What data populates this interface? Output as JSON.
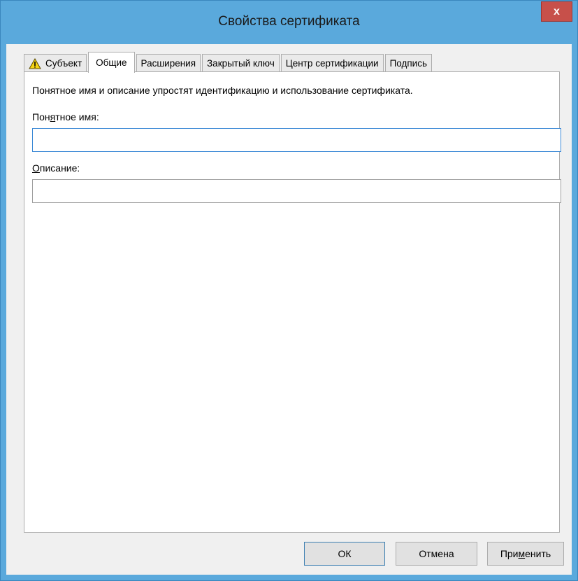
{
  "window": {
    "title": "Свойства сертификата",
    "close_label": "x"
  },
  "tabs": [
    {
      "label": "Субъект",
      "icon": "warning-icon"
    },
    {
      "label": "Общие"
    },
    {
      "label": "Расширения"
    },
    {
      "label": "Закрытый ключ"
    },
    {
      "label": "Центр сертификации"
    },
    {
      "label": "Подпись"
    }
  ],
  "general": {
    "description": "Понятное имя и описание упростят идентификацию и использование сертификата.",
    "friendly_name_label": {
      "before": "Пон",
      "underlined": "я",
      "after": "тное имя:"
    },
    "friendly_name_value": "",
    "description_label": {
      "before": "",
      "underlined": "О",
      "after": "писание:"
    },
    "description_value": ""
  },
  "buttons": {
    "ok": "ОК",
    "cancel": "Отмена",
    "apply": {
      "before": "При",
      "underlined": "м",
      "after": "енить"
    }
  }
}
